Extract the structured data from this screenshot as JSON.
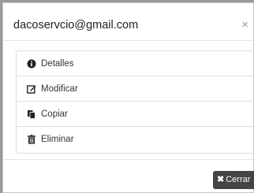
{
  "modal": {
    "title": "dacoservcio@gmail.com",
    "close_symbol": "×"
  },
  "menu": {
    "items": [
      {
        "label": "Detalles",
        "icon": "info-circle-icon"
      },
      {
        "label": "Modificar",
        "icon": "edit-icon"
      },
      {
        "label": "Copiar",
        "icon": "copy-icon"
      },
      {
        "label": "Eliminar",
        "icon": "trash-icon"
      }
    ]
  },
  "footer": {
    "close_label": "Cerrar",
    "close_icon": "✖"
  },
  "colors": {
    "backdrop": "#9a9a9a",
    "button_bg": "#444444",
    "border": "#dddddd"
  }
}
